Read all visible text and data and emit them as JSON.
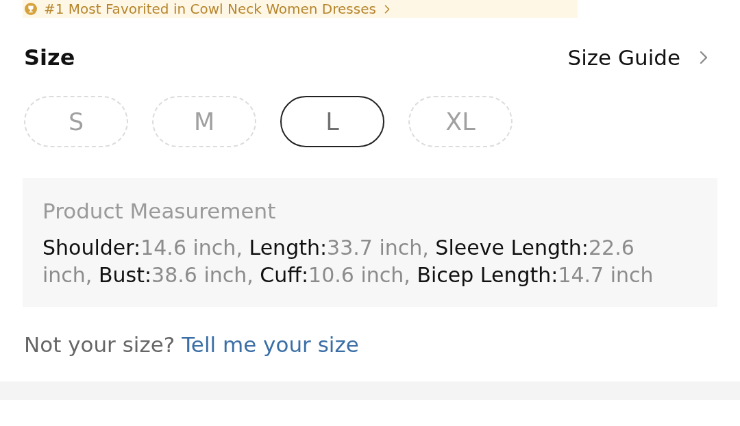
{
  "banner": {
    "text": "#1 Most Favorited in Cowl Neck Women Dresses"
  },
  "size_section": {
    "title": "Size",
    "size_guide": "Size Guide",
    "sizes": [
      {
        "label": "S",
        "selected": false,
        "disabled": true
      },
      {
        "label": "M",
        "selected": false,
        "disabled": true
      },
      {
        "label": "L",
        "selected": true,
        "disabled": false
      },
      {
        "label": "XL",
        "selected": false,
        "disabled": true
      }
    ]
  },
  "measurement": {
    "title": "Product Measurement",
    "items": [
      {
        "label": "Shoulder:",
        "value": "14.6 inch,"
      },
      {
        "label": "Length:",
        "value": "33.7 inch,"
      },
      {
        "label": "Sleeve Length:",
        "value": "22.6 inch,"
      },
      {
        "label": "Bust:",
        "value": "38.6 inch,"
      },
      {
        "label": "Cuff:",
        "value": "10.6 inch,"
      },
      {
        "label": "Bicep Length:",
        "value": "14.7 inch"
      }
    ]
  },
  "size_help": {
    "prompt": "Not your size?",
    "link": "Tell me your size"
  }
}
